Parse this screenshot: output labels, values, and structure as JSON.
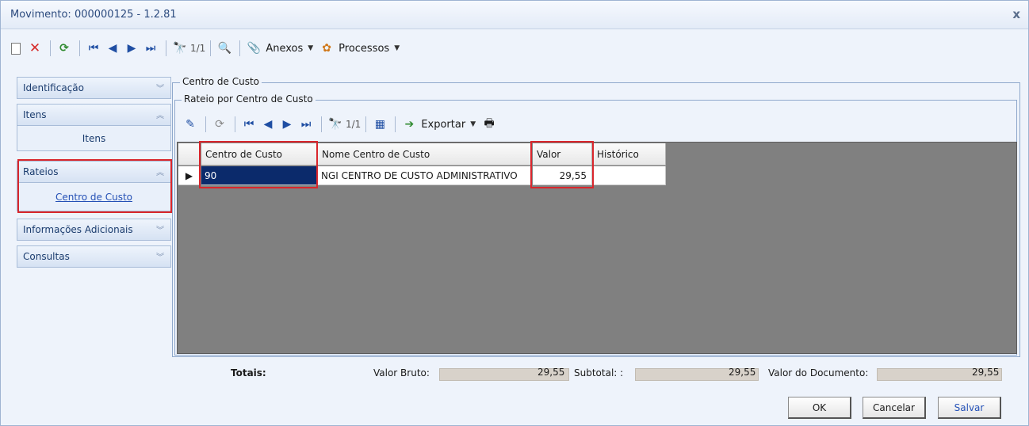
{
  "window": {
    "title": "Movimento: 000000125 - 1.2.81",
    "close": "x"
  },
  "toolbar": {
    "record_position": "1/1",
    "anexos_label": "Anexos",
    "processos_label": "Processos"
  },
  "sidebar": {
    "identificacao": "Identificação",
    "itens_header": "Itens",
    "itens_item": "Itens",
    "rateios_header": "Rateios",
    "centro_de_custo_link": "Centro de Custo",
    "informacoes_adicionais": "Informações Adicionais",
    "consultas": "Consultas"
  },
  "groups": {
    "centro_de_custo": "Centro de Custo",
    "rateio_por_centro_de_custo": "Rateio por Centro de Custo"
  },
  "grid_toolbar": {
    "record_position": "1/1",
    "exportar_label": "Exportar"
  },
  "grid": {
    "columns": [
      "Centro de Custo",
      "Nome Centro de Custo",
      "Valor",
      "Histórico"
    ],
    "rows": [
      {
        "centro_de_custo": "90",
        "nome": "NGI CENTRO DE CUSTO ADMINISTRATIVO",
        "valor": "29,55",
        "historico": ""
      }
    ]
  },
  "totals": {
    "label": "Totais:",
    "valor_bruto_label": "Valor Bruto:",
    "valor_bruto": "29,55",
    "subtotal_label": "Subtotal: :",
    "subtotal": "29,55",
    "valor_documento_label": "Valor do Documento:",
    "valor_documento": "29,55"
  },
  "buttons": {
    "ok": "OK",
    "cancelar": "Cancelar",
    "salvar": "Salvar"
  },
  "colors": {
    "highlight_red": "#d9262c",
    "grid_background": "#808080",
    "selected_cell": "#0b2a6b"
  }
}
